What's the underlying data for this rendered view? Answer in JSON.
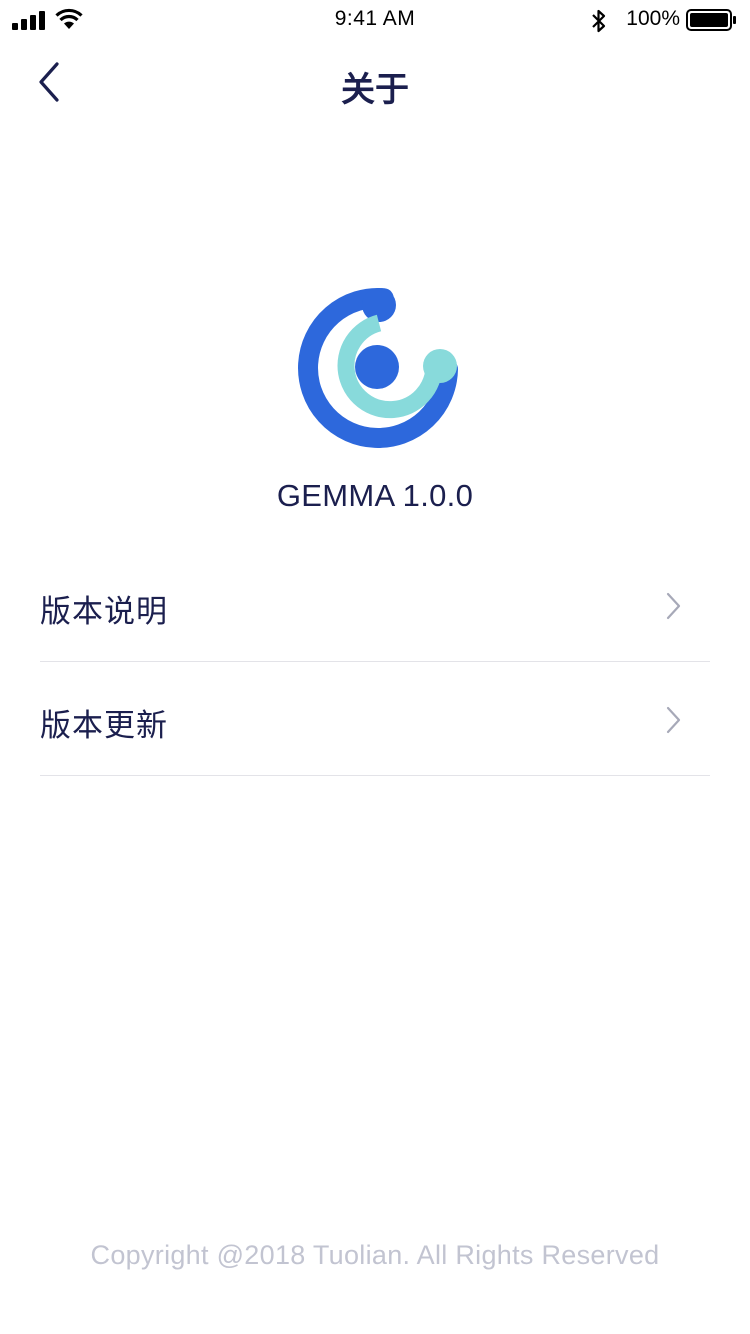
{
  "status_bar": {
    "time": "9:41 AM",
    "battery_percent": "100%",
    "battery_level": 1.0,
    "icons": [
      "signal-icon",
      "wifi-icon",
      "bluetooth-icon",
      "battery-icon"
    ]
  },
  "nav": {
    "back_icon": "chevron-left-icon",
    "title": "关于"
  },
  "app": {
    "logo_icon": "gemma-logo-icon",
    "version_label": "GEMMA 1.0.0"
  },
  "menu": {
    "items": [
      {
        "label": "版本说明",
        "icon": "chevron-right-icon"
      },
      {
        "label": "版本更新",
        "icon": "chevron-right-icon"
      }
    ]
  },
  "footer": {
    "copyright": "Copyright @2018 Tuolian. All Rights Reserved"
  },
  "colors": {
    "primary_text": "#1b1f4e",
    "logo_blue": "#2d68dc",
    "logo_teal": "#88dadb",
    "divider": "#e3e3e8",
    "muted_text": "#c2c4d1",
    "chevron": "#a7a9b8"
  }
}
